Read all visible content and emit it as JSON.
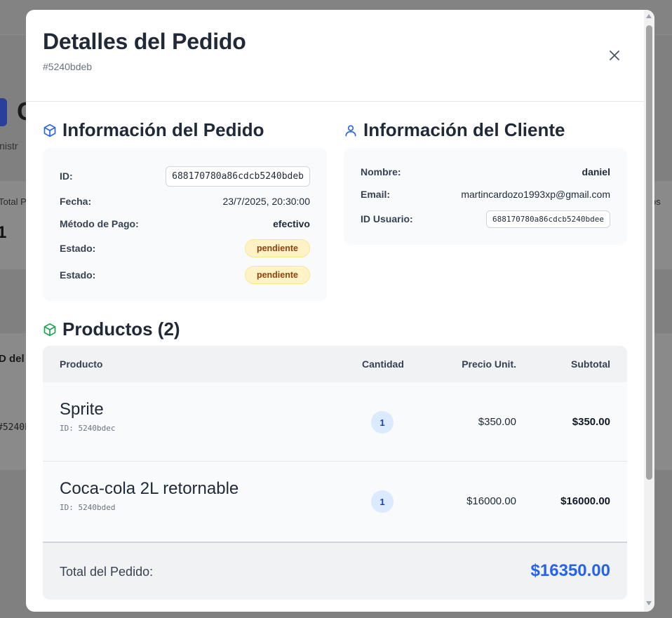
{
  "background": {
    "title_fragment": "C",
    "subtitle_fragment": "inistr",
    "card_label": "Total P",
    "card_value": "1",
    "card_right_label": "os",
    "table_header": "D del",
    "table_id": "#5240b"
  },
  "modal": {
    "title": "Detalles del Pedido",
    "order_ref": "#5240bdeb",
    "close_icon": "close-icon"
  },
  "order_info": {
    "title": "Información del Pedido",
    "icon": "box-icon",
    "id_label": "ID:",
    "id_value": "688170780a86cdcb5240bdeb",
    "date_label": "Fecha:",
    "date_value": "23/7/2025, 20:30:00",
    "payment_label": "Método de Pago:",
    "payment_value": "efectivo",
    "status_label": "Estado:",
    "status_value": "pendiente",
    "status2_label": "Estado:",
    "status2_value": "pendiente"
  },
  "client_info": {
    "title": "Información del Cliente",
    "icon": "user-icon",
    "name_label": "Nombre:",
    "name_value": "daniel",
    "email_label": "Email:",
    "email_value": "martincardozo1993xp@gmail.com",
    "user_id_label": "ID Usuario:",
    "user_id_value": "688170780a86cdcb5240bdee"
  },
  "products": {
    "title": "Productos (2)",
    "icon": "box-icon",
    "columns": [
      "Producto",
      "Cantidad",
      "Precio Unit.",
      "Subtotal"
    ],
    "rows": [
      {
        "name": "Sprite",
        "id": "ID: 5240bdec",
        "qty": "1",
        "price": "$350.00",
        "subtotal": "$350.00"
      },
      {
        "name": "Coca-cola 2L retornable",
        "id": "ID: 5240bded",
        "qty": "1",
        "price": "$16000.00",
        "subtotal": "$16000.00"
      }
    ],
    "total_label": "Total del Pedido:",
    "total_value": "$16350.00"
  },
  "colors": {
    "accent": "#2563eb",
    "order_icon": "#2563eb",
    "product_icon": "#16a34a",
    "badge_bg": "#fef3c7"
  }
}
